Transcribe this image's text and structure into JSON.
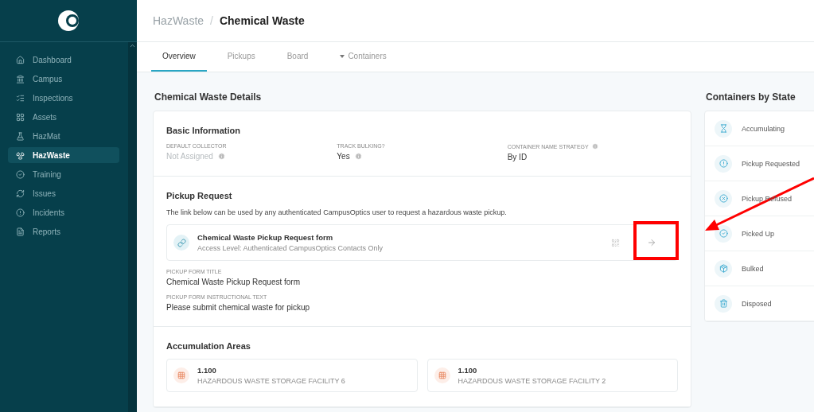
{
  "sidebar": {
    "items": [
      {
        "label": "Dashboard",
        "selected": false
      },
      {
        "label": "Campus",
        "selected": false
      },
      {
        "label": "Inspections",
        "selected": false
      },
      {
        "label": "Assets",
        "selected": false
      },
      {
        "label": "HazMat",
        "selected": false
      },
      {
        "label": "HazWaste",
        "selected": true
      },
      {
        "label": "Training",
        "selected": false
      },
      {
        "label": "Issues",
        "selected": false
      },
      {
        "label": "Incidents",
        "selected": false
      },
      {
        "label": "Reports",
        "selected": false
      }
    ]
  },
  "breadcrumb": {
    "parent": "HazWaste",
    "separator": "/",
    "current": "Chemical Waste"
  },
  "tabs": [
    {
      "label": "Overview",
      "selected": true,
      "kind": "plain"
    },
    {
      "label": "Pickups",
      "selected": false,
      "kind": "plain"
    },
    {
      "label": "Board",
      "selected": false,
      "kind": "plain"
    },
    {
      "label": "Containers",
      "selected": false,
      "kind": "dropdown"
    }
  ],
  "details": {
    "title": "Chemical Waste Details",
    "basic_information": {
      "title": "Basic Information",
      "fields": [
        {
          "label": "DEFAULT COLLECTOR",
          "value": "Not Assigned",
          "muted": true,
          "info": true
        },
        {
          "label": "TRACK BULKING?",
          "value": "Yes",
          "muted": false,
          "info": true
        },
        {
          "label": "CONTAINER NAME STRATEGY",
          "value": "By ID",
          "muted": false,
          "label_info": true
        }
      ]
    },
    "pickup_request": {
      "title": "Pickup Request",
      "description": "The link below can be used by any authenticated CampusOptics user to request a hazardous waste pickup.",
      "link": {
        "title": "Chemical Waste Pickup Request form",
        "subtitle": "Access Level: Authenticated CampusOptics Contacts Only"
      },
      "fields": [
        {
          "label": "PICKUP FORM TITLE",
          "value": "Chemical Waste Pickup Request form"
        },
        {
          "label": "PICKUP FORM INSTRUCTIONAL TEXT",
          "value": "Please submit chemical waste for pickup"
        }
      ]
    },
    "accumulation_areas": {
      "title": "Accumulation Areas",
      "areas": [
        {
          "code": "1.100",
          "name": "HAZARDOUS WASTE STORAGE FACILITY 6"
        },
        {
          "code": "1.100",
          "name": "HAZARDOUS WASTE STORAGE FACILITY 2"
        }
      ]
    }
  },
  "containers_by_state": {
    "title": "Containers by State",
    "states": [
      {
        "label": "Accumulating"
      },
      {
        "label": "Pickup Requested"
      },
      {
        "label": "Pickup Refused"
      },
      {
        "label": "Picked Up"
      },
      {
        "label": "Bulked"
      },
      {
        "label": "Disposed"
      }
    ]
  },
  "annotations": {
    "highlight_box": true,
    "pointer_arrow": true
  }
}
